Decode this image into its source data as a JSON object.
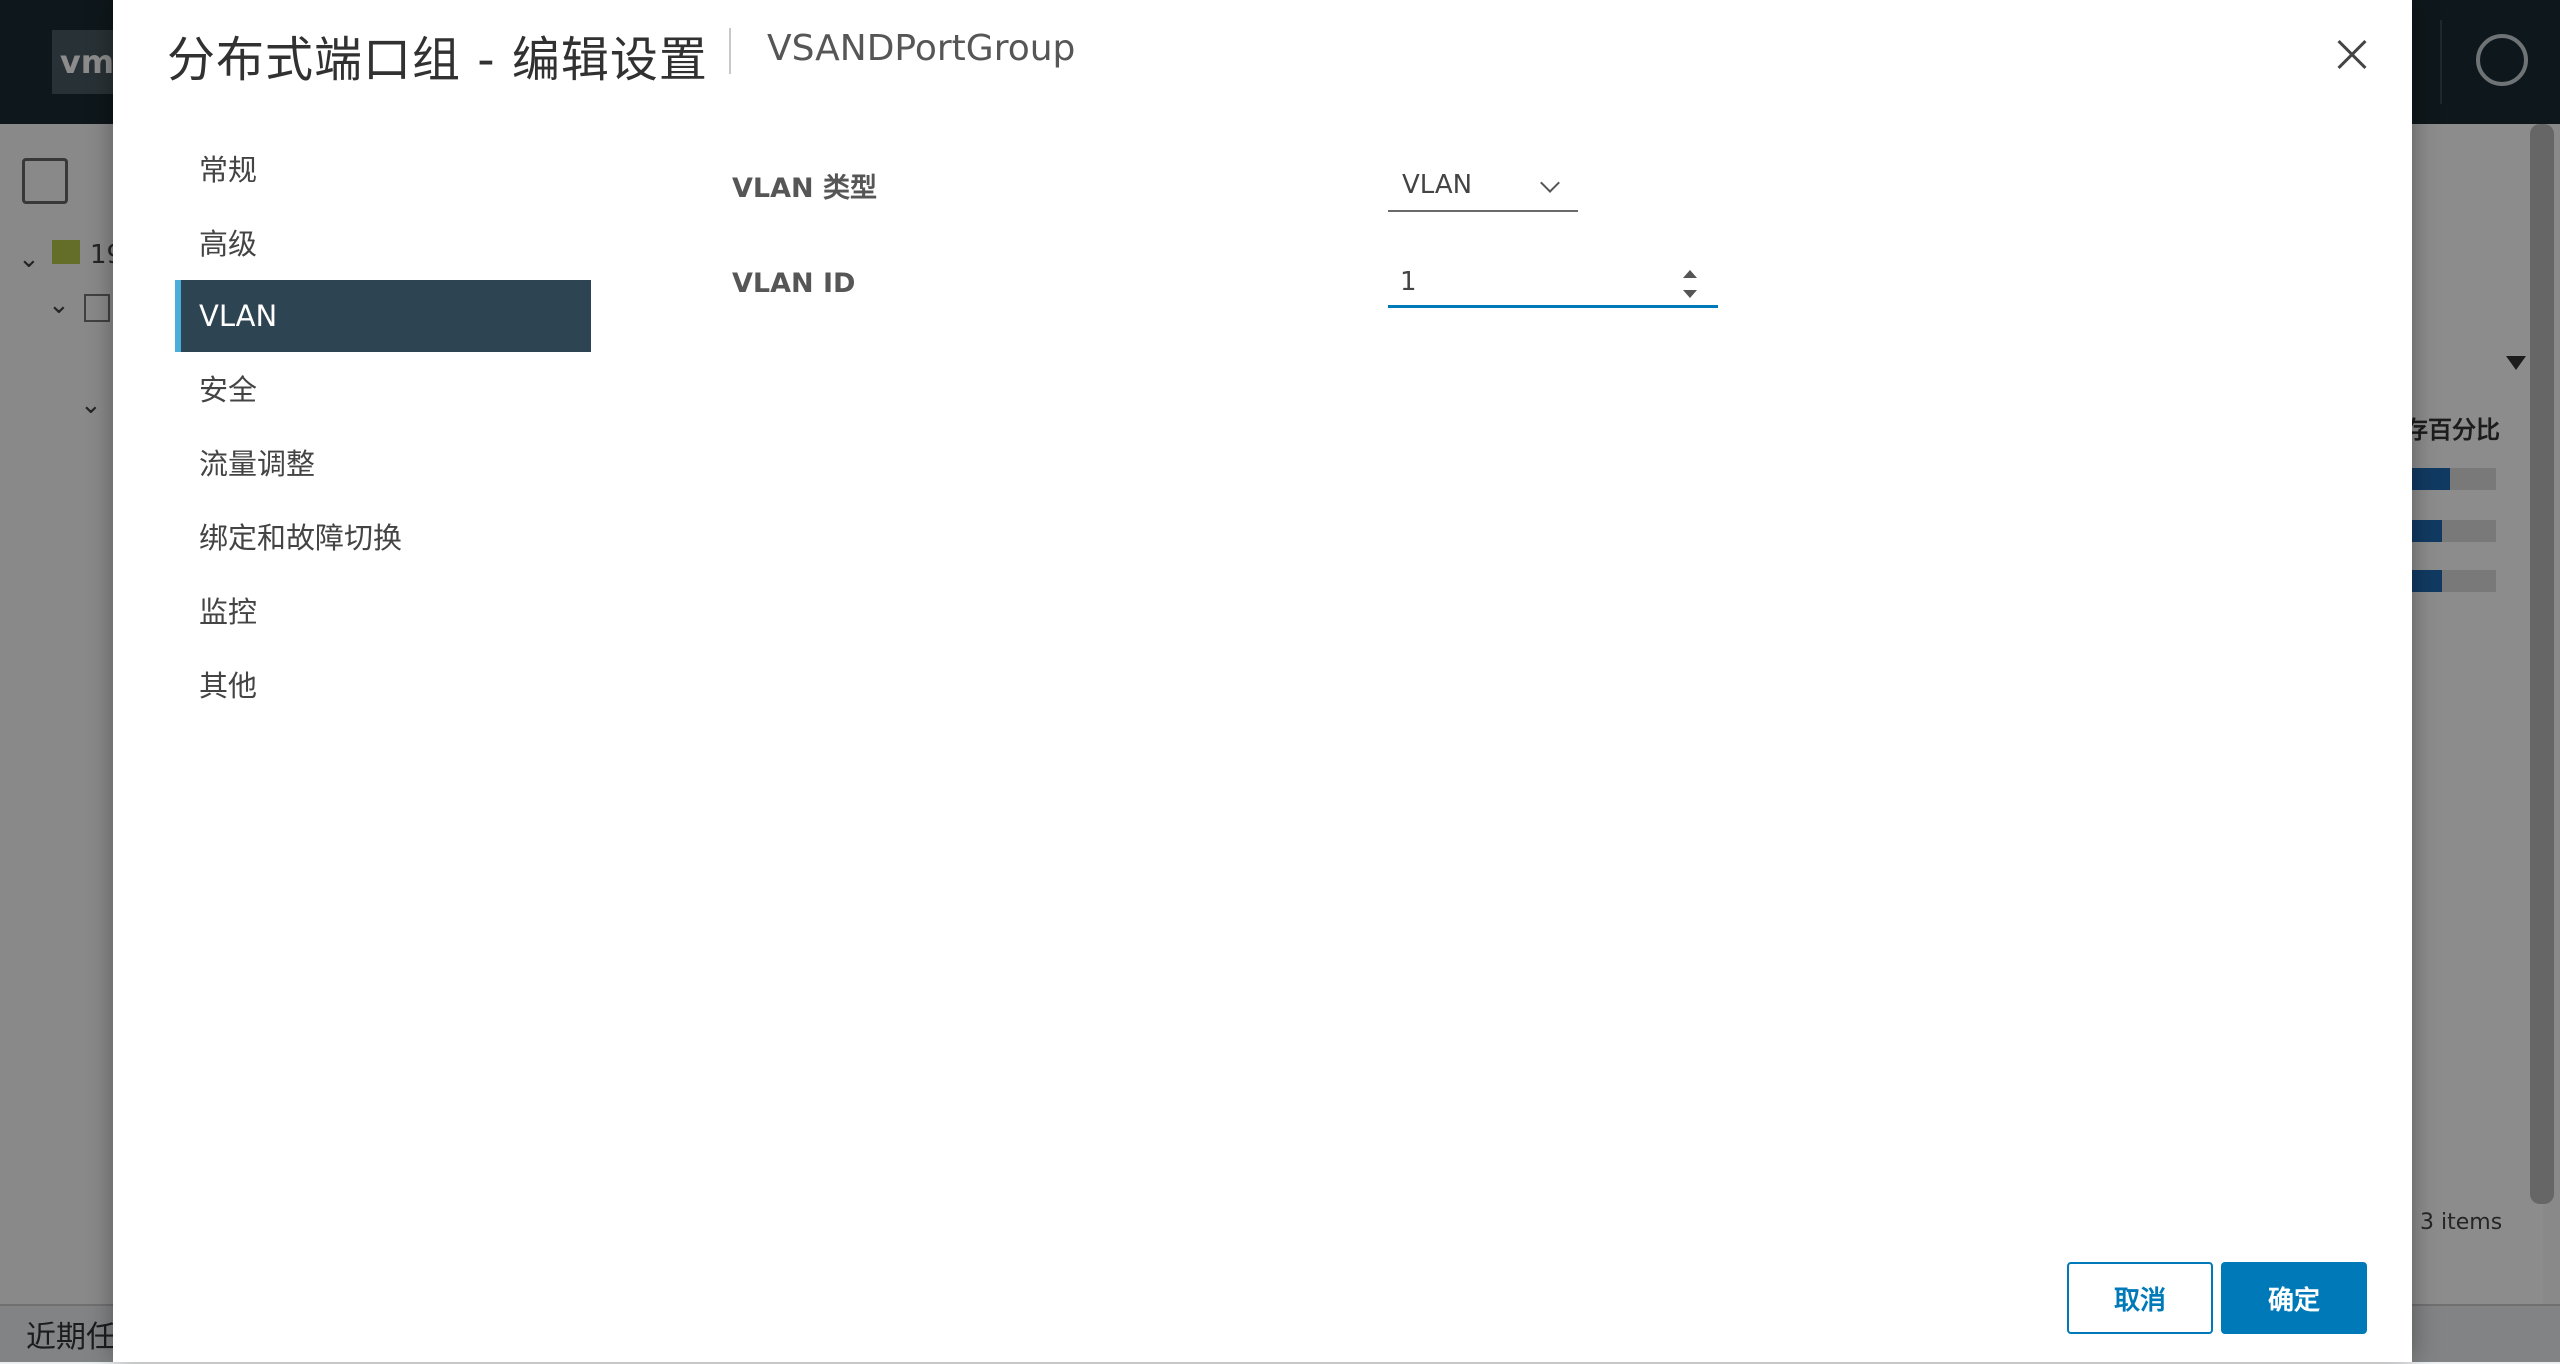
{
  "background": {
    "logo_text": "vm",
    "tree_items": [
      "19",
      ""
    ],
    "column_header": "存百分比",
    "items_count": "3 items",
    "bottom_label": "近期任",
    "bar_fill_fractions": [
      0.5,
      0.4,
      0.4
    ]
  },
  "dialog": {
    "title": "分布式端口组 - 编辑设置",
    "subtitle": "VSANDPortGroup",
    "nav": {
      "items": [
        {
          "label": "常规"
        },
        {
          "label": "高级"
        },
        {
          "label": "VLAN"
        },
        {
          "label": "安全"
        },
        {
          "label": "流量调整"
        },
        {
          "label": "绑定和故障切换"
        },
        {
          "label": "监控"
        },
        {
          "label": "其他"
        }
      ],
      "active": "VLAN"
    },
    "form": {
      "vlan_type_label": "VLAN 类型",
      "vlan_type_value": "VLAN",
      "vlan_id_label": "VLAN ID",
      "vlan_id_value": "1"
    },
    "buttons": {
      "cancel": "取消",
      "ok": "确定"
    }
  },
  "colors": {
    "accent": "#0079b8",
    "nav_active_bg": "#2d4452",
    "nav_active_border": "#49afd9",
    "header_bg": "#1b2a32"
  }
}
